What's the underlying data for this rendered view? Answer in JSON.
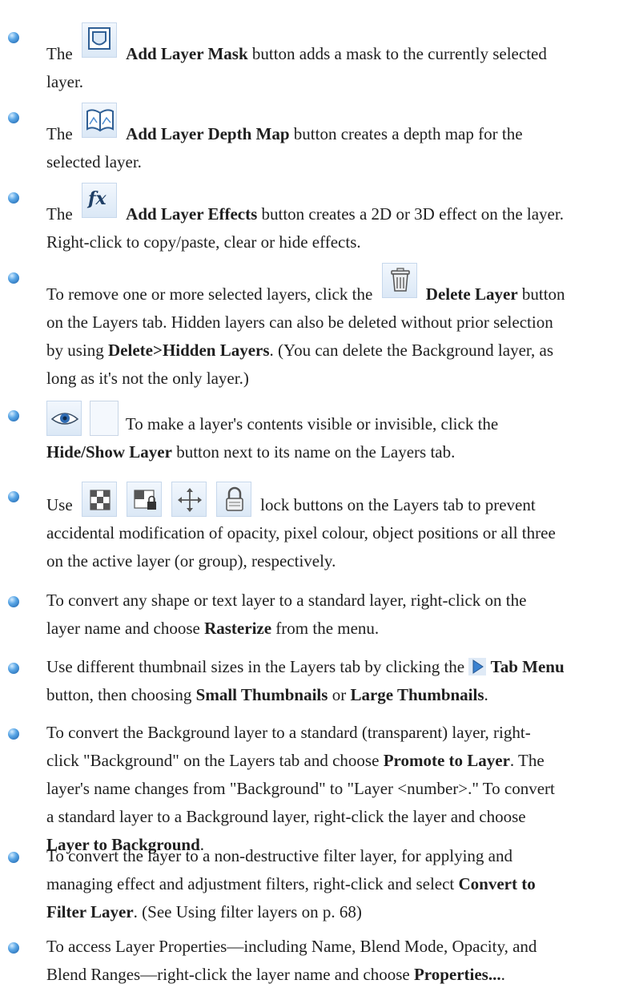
{
  "items": [
    {
      "a": "The",
      "b": "Add Layer Mask",
      "c": "button adds a mask to the currently selected",
      "d": "layer."
    },
    {
      "a": "The",
      "b": "Add Layer Depth Map",
      "c": "button creates a depth map for the",
      "d": "selected layer."
    },
    {
      "a": "The",
      "b": "Add Layer Effects",
      "c": "button creates a 2D or 3D effect on the layer.",
      "d": "Right-click to copy/paste, clear or hide effects."
    },
    {
      "a": "To remove one or more selected layers, click the",
      "b": "Delete Layer",
      "c": "button",
      "d": "on the Layers tab. Hidden layers can also be deleted without prior selection",
      "e": "by using",
      "f": "Delete>Hidden Layers",
      "g": ". (You can delete the Background layer, as",
      "h": "long as it's not the only layer.)"
    },
    {
      "a": "To make a layer's contents visible or invisible, click the",
      "b": "Hide/Show Layer",
      "c": "button next to its name on the Layers tab."
    },
    {
      "a": "Use",
      "b": "lock buttons on the Layers tab to prevent",
      "c": "accidental modification of opacity, pixel colour, object positions or all three",
      "d": "on the active layer (or group), respectively."
    },
    {
      "a": "To convert any shape or text layer to a standard layer, right-click on the",
      "b": "layer name and choose",
      "c": "Rasterize",
      "d": "from the menu."
    },
    {
      "a": "Use different thumbnail sizes in the Layers tab by clicking the",
      "b": "Tab Menu",
      "c": "button, then choosing",
      "d": "Small Thumbnails",
      "e": "or",
      "f": "Large Thumbnails",
      "g": "."
    },
    {
      "a": "To convert the Background layer to a standard (transparent) layer, right-",
      "b": "click \"Background\" on the Layers tab and choose",
      "c": "Promote to Layer",
      "d": ". The",
      "e": "layer's name changes from \"Background\" to \"Layer <number>.\" To convert",
      "f": "a standard layer to a Background layer, right-click the layer and choose",
      "g": "Layer to Background",
      "h": "."
    },
    {
      "a": "To convert the layer to a non-destructive filter layer, for applying and",
      "b": "managing effect and adjustment filters, right-click and select",
      "c": "Convert to",
      "d": "Filter Layer",
      "e": ". (See Using filter layers on p. 68)"
    },
    {
      "a": "To access Layer Properties—including Name, Blend Mode, Opacity, and",
      "b": "Blend Ranges—right-click the layer name and choose",
      "c": "Properties...",
      "d": "."
    }
  ]
}
